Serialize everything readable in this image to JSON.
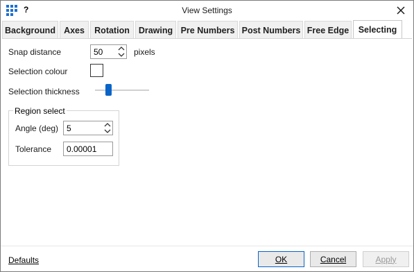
{
  "window": {
    "title": "View Settings",
    "help_label": "?"
  },
  "tabs": [
    {
      "label": "Background",
      "active": false
    },
    {
      "label": "Axes",
      "active": false
    },
    {
      "label": "Rotation",
      "active": false
    },
    {
      "label": "Drawing",
      "active": false
    },
    {
      "label": "Pre Numbers",
      "active": false
    },
    {
      "label": "Post Numbers",
      "active": false
    },
    {
      "label": "Free Edge",
      "active": false
    },
    {
      "label": "Selecting",
      "active": true
    }
  ],
  "selecting": {
    "snap_label": "Snap distance",
    "snap_value": "50",
    "snap_unit": "pixels",
    "colour_label": "Selection colour",
    "colour_value": "#ffffff",
    "thickness_label": "Selection thickness",
    "thickness_level": 0.25,
    "region": {
      "title": "Region select",
      "angle_label": "Angle (deg)",
      "angle_value": "5",
      "tolerance_label": "Tolerance",
      "tolerance_value": "0.00001"
    }
  },
  "footer": {
    "defaults_label": "Defaults",
    "ok_label": "OK",
    "cancel_label": "Cancel",
    "apply_label": "Apply"
  },
  "colors": {
    "accent": "#0a64c8",
    "app_icon": "#1e6fd0"
  }
}
